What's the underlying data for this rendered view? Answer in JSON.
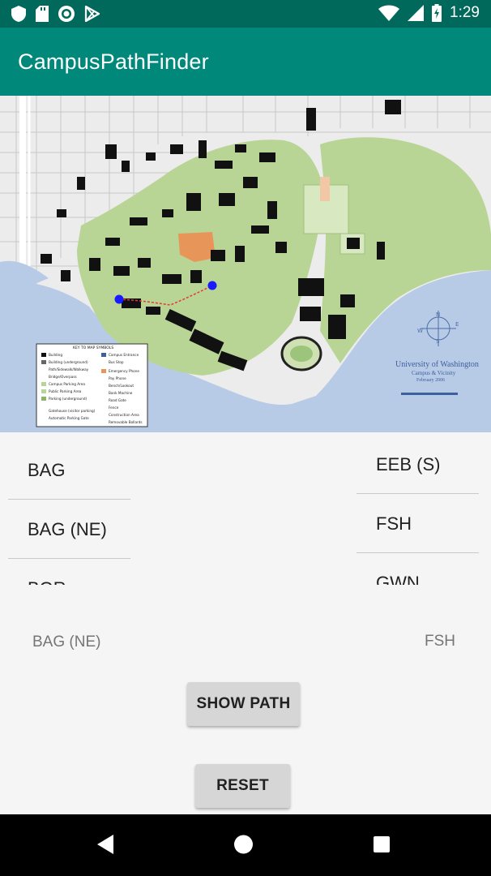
{
  "status_bar": {
    "time": "1:29",
    "left_icons": [
      "shield-icon",
      "sd-card-icon",
      "sync-circle-icon",
      "play-store-icon"
    ],
    "right_icons": [
      "wifi-icon",
      "signal-icon",
      "battery-icon"
    ]
  },
  "app_bar": {
    "title": "CampusPathFinder"
  },
  "map": {
    "legend_title": "KEY TO MAP SYMBOLS",
    "legend_items_left": [
      "Building",
      "Building (underground)",
      "Path/Sidewalk/Walkway",
      "Bridge/Overpass",
      "Campus Parking Area",
      "Public Parking Area",
      "Parking (underground)",
      "Gatehouse (visitor parking)",
      "Automatic Parking Gate"
    ],
    "legend_items_right": [
      "Campus Entrance",
      "Bus Stop",
      "Emergency Phone",
      "Pay Phone",
      "Bench/Lookout",
      "Bank Machine",
      "Road Gate",
      "Fence",
      "Construction Area",
      "Removable Bollards"
    ],
    "uw_title": "University of Washington",
    "uw_subtitle": "Campus & Vicinity",
    "uw_date": "February 2006",
    "compass_letters": [
      "N",
      "E",
      "S",
      "W"
    ],
    "colors": {
      "water": "#b8cbe6",
      "park": "#b9d596",
      "building": "#111111",
      "highlight": "#e8955a",
      "marker": "#1a1aff"
    }
  },
  "start_list": [
    "BAG",
    "BAG (NE)",
    "BGR"
  ],
  "dest_list": [
    "EEB (S)",
    "FSH",
    "GWN"
  ],
  "selected_start": "BAG (NE)",
  "selected_dest": "FSH",
  "buttons": {
    "show_path": "SHOW PATH",
    "reset": "RESET"
  },
  "nav_bar": {
    "back": "back-icon",
    "home": "home-icon",
    "recent": "recent-apps-icon"
  }
}
